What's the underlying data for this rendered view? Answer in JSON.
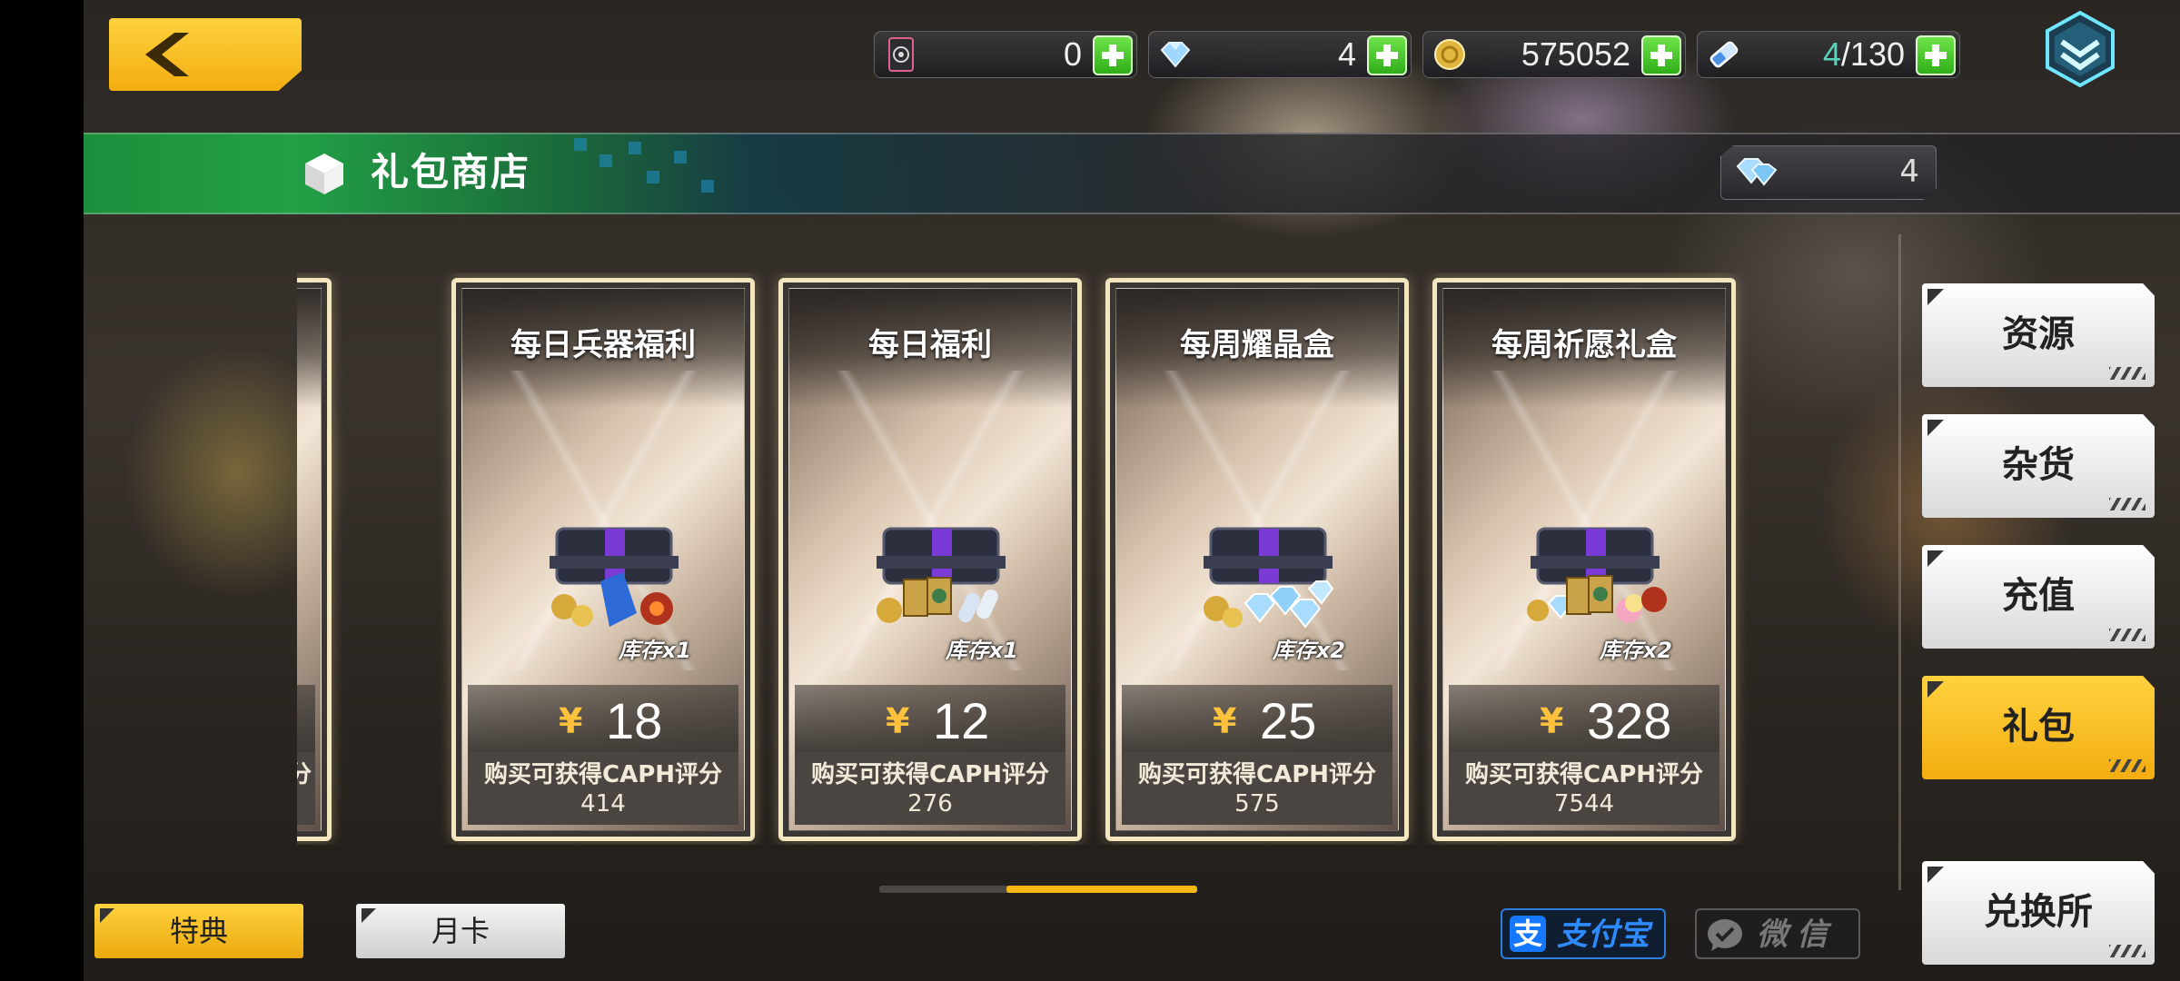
{
  "topbar": {
    "resources": [
      {
        "name": "pass-card",
        "value": "0",
        "icon": "emblem-card-icon"
      },
      {
        "name": "diamonds",
        "value": "4",
        "icon": "diamond-icon"
      },
      {
        "name": "gold",
        "value": "575052",
        "icon": "gold-coin-icon"
      },
      {
        "name": "stamina",
        "value_current": "4",
        "value_max": "/130",
        "icon": "battery-icon"
      }
    ]
  },
  "shop": {
    "title": "礼包商店",
    "diamond_balance": "4"
  },
  "partial_card_fragment": "分",
  "cards": [
    {
      "title": "每日兵器福利",
      "stock": "库存x1",
      "currency": "¥",
      "price": "18",
      "caph_label": "购买可获得CAPH评分",
      "caph_value": "414"
    },
    {
      "title": "每日福利",
      "stock": "库存x1",
      "currency": "¥",
      "price": "12",
      "caph_label": "购买可获得CAPH评分",
      "caph_value": "276"
    },
    {
      "title": "每周耀晶盒",
      "stock": "库存x2",
      "currency": "¥",
      "price": "25",
      "caph_label": "购买可获得CAPH评分",
      "caph_value": "575"
    },
    {
      "title": "每周祈愿礼盒",
      "stock": "库存x2",
      "currency": "¥",
      "price": "328",
      "caph_label": "购买可获得CAPH评分",
      "caph_value": "7544"
    }
  ],
  "side_tabs": [
    {
      "label": "资源",
      "active": false
    },
    {
      "label": "杂货",
      "active": false
    },
    {
      "label": "充值",
      "active": false
    },
    {
      "label": "礼包",
      "active": true
    },
    {
      "label": "兑换所",
      "active": false
    }
  ],
  "bottom_tabs": [
    {
      "label": "特典",
      "active": true
    },
    {
      "label": "月卡",
      "active": false
    }
  ],
  "payment": {
    "alipay_mark": "支",
    "alipay_label": "支付宝",
    "wechat_label": "微信"
  },
  "colors": {
    "accent_yellow": "#f6b712",
    "plus_green": "#3fc21f",
    "title_green": "#1d8f3c",
    "alipay_blue": "#1677ff"
  }
}
